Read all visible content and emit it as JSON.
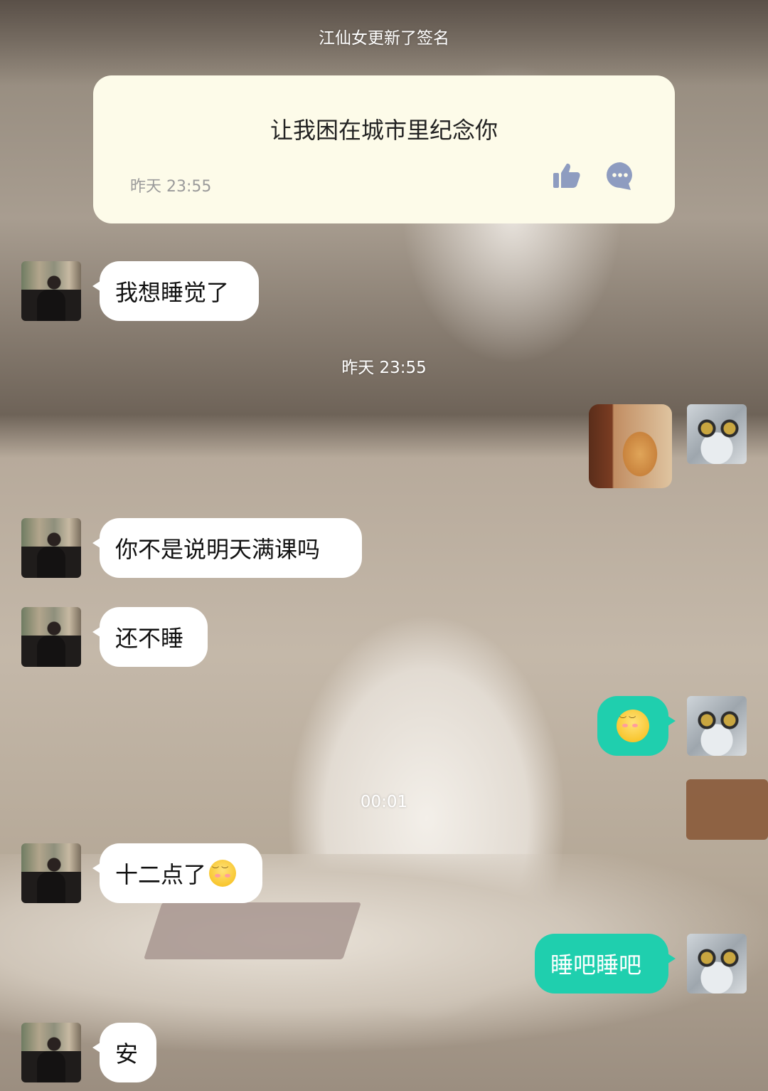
{
  "system": {
    "signature_update": "江仙女更新了签名",
    "timestamp_1": "昨天 23:55",
    "timestamp_2": "00:01"
  },
  "signature_card": {
    "text": "让我困在城市里纪念你",
    "time": "昨天 23:55",
    "like_icon": "thumbs-up-icon",
    "comment_icon": "comment-bubble-icon"
  },
  "messages": [
    {
      "side": "in",
      "text": "我想睡觉了"
    },
    {
      "side": "out",
      "type": "sticker",
      "sticker": "peeking-cat-sticker"
    },
    {
      "side": "in",
      "text": "你不是说明天满课吗"
    },
    {
      "side": "in",
      "text": "还不睡"
    },
    {
      "side": "out",
      "type": "emoji",
      "emoji": "blushing-smiley"
    },
    {
      "side": "in",
      "text": "十二点了",
      "emoji": "blushing-smiley"
    },
    {
      "side": "out",
      "text": "睡吧睡吧"
    },
    {
      "side": "in",
      "text": "安"
    }
  ],
  "colors": {
    "outgoing_bubble": "#1fcfae",
    "incoming_bubble": "#ffffff",
    "signature_card": "#fdfbe9"
  }
}
